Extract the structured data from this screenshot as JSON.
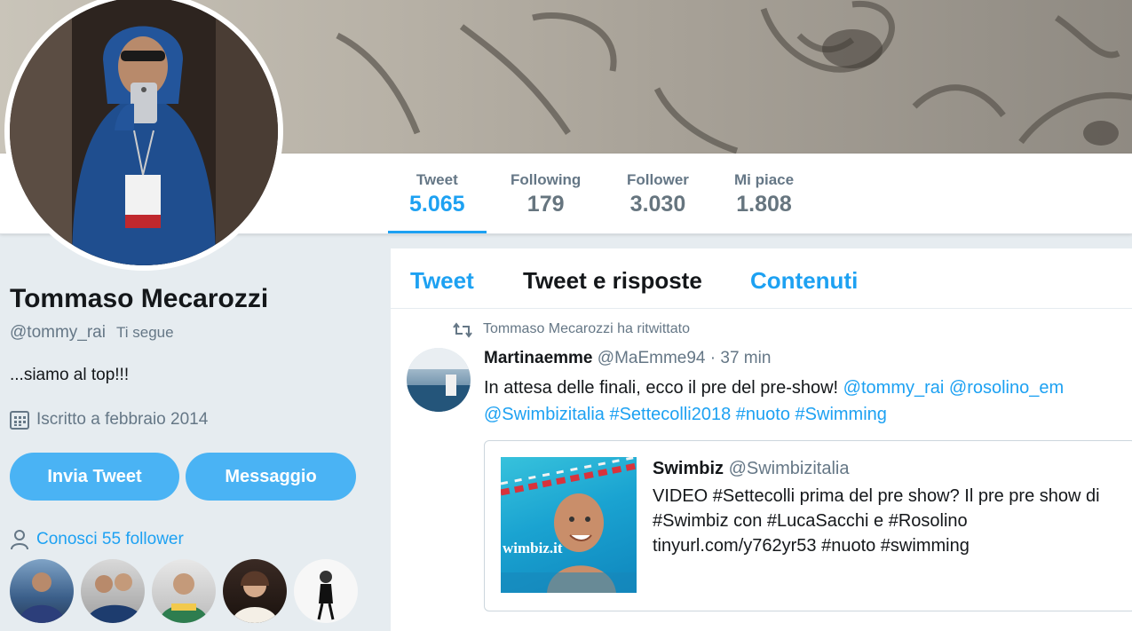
{
  "nav": {
    "stats": [
      {
        "label": "Tweet",
        "value": "5.065",
        "active": true
      },
      {
        "label": "Following",
        "value": "179",
        "active": false
      },
      {
        "label": "Follower",
        "value": "3.030",
        "active": false
      },
      {
        "label": "Mi piace",
        "value": "1.808",
        "active": false
      }
    ]
  },
  "profile": {
    "name": "Tommaso Mecarozzi",
    "handle": "@tommy_rai",
    "follows_you": "Ti segue",
    "bio": "...siamo al top!!!",
    "joined": "Iscritto a febbraio 2014",
    "tweet_button": "Invia Tweet",
    "message_button": "Messaggio",
    "known_followers": "Conosci 55 follower"
  },
  "icons": {
    "calendar": "calendar-icon",
    "person": "person-icon",
    "retweet": "retweet-icon"
  },
  "timeline": {
    "tabs": [
      {
        "label": "Tweet"
      },
      {
        "label": "Tweet e risposte"
      },
      {
        "label": "Contenuti"
      }
    ],
    "tweet": {
      "retweet_context": "Tommaso Mecarozzi ha ritwittato",
      "author_name": "Martinaemme",
      "author_handle": "@MaEmme94",
      "time": "· 37 min",
      "text": "In attesa delle finali, ecco il pre del pre-show!",
      "mentions": [
        "@tommy_rai",
        "@rosolino_em"
      ],
      "tags": [
        "@Swimbizitalia",
        "#Settecolli2018",
        "#nuoto",
        "#Swimming"
      ],
      "quote": {
        "author_name": "Swimbiz",
        "author_handle": "@Swimbizitalia",
        "text": "VIDEO #Settecolli prima del pre show? Il pre pre show di #Swimbiz con #LucaSacchi e #Rosolino tinyurl.com/y762yr53  #nuoto #swimming",
        "image_watermark": "wimbiz.it"
      }
    }
  },
  "colors": {
    "accent": "#1da1f2",
    "button": "#4ab3f4",
    "muted": "#657786",
    "background": "#e6ecf0"
  }
}
